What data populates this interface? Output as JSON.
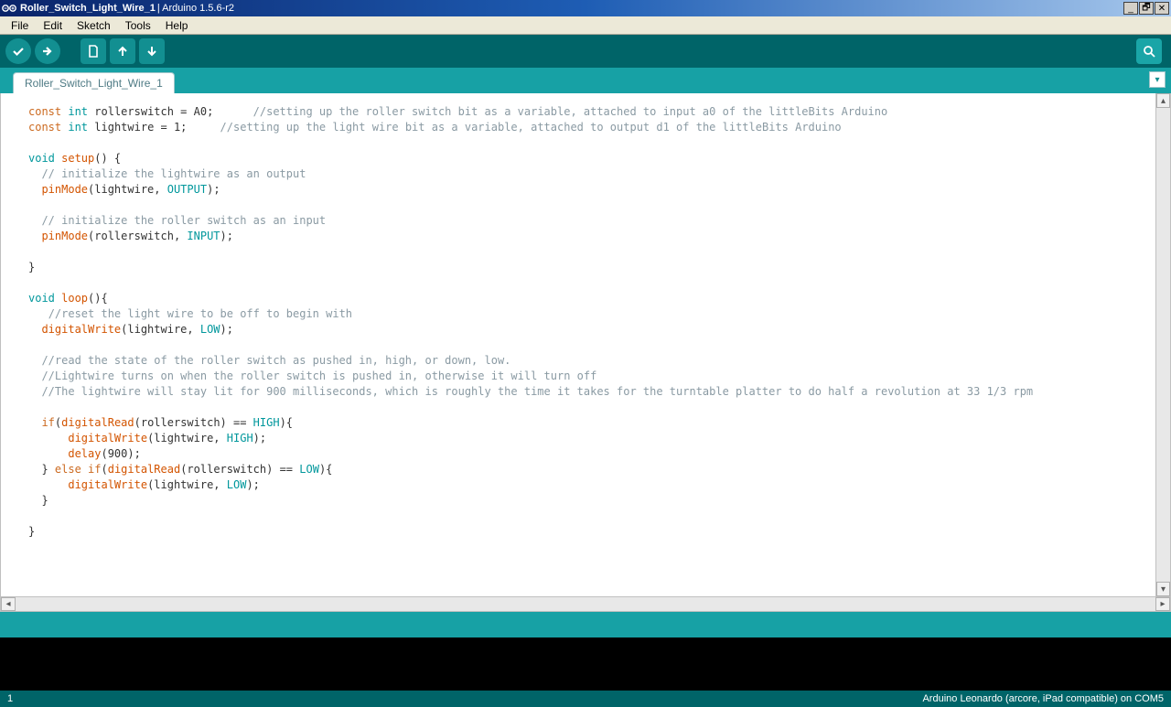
{
  "window": {
    "title_prefix": "Roller_Switch_Light_Wire_1",
    "title_suffix": " | Arduino 1.5.6-r2"
  },
  "menus": {
    "file": "File",
    "edit": "Edit",
    "sketch": "Sketch",
    "tools": "Tools",
    "help": "Help"
  },
  "tab": {
    "name": "Roller_Switch_Light_Wire_1"
  },
  "code": {
    "lines": [
      [
        [
          "kw",
          "const "
        ],
        [
          "type",
          "int "
        ],
        [
          "",
          "rollerswitch = A0;      "
        ],
        [
          "cmt",
          "//setting up the roller switch bit as a variable, attached to input a0 of the littleBits Arduino"
        ]
      ],
      [
        [
          "kw",
          "const "
        ],
        [
          "type",
          "int "
        ],
        [
          "",
          "lightwire = 1;     "
        ],
        [
          "cmt",
          "//setting up the light wire bit as a variable, attached to output d1 of the littleBits Arduino"
        ]
      ],
      [
        [
          "",
          ""
        ]
      ],
      [
        [
          "type",
          "void "
        ],
        [
          "func",
          "setup"
        ],
        [
          "",
          "() {"
        ]
      ],
      [
        [
          "",
          "  "
        ],
        [
          "cmt",
          "// initialize the lightwire as an output"
        ]
      ],
      [
        [
          "",
          "  "
        ],
        [
          "func",
          "pinMode"
        ],
        [
          "",
          "(lightwire, "
        ],
        [
          "lit",
          "OUTPUT"
        ],
        [
          "",
          ");"
        ]
      ],
      [
        [
          "",
          ""
        ]
      ],
      [
        [
          "",
          "  "
        ],
        [
          "cmt",
          "// initialize the roller switch as an input"
        ]
      ],
      [
        [
          "",
          "  "
        ],
        [
          "func",
          "pinMode"
        ],
        [
          "",
          "(rollerswitch, "
        ],
        [
          "lit",
          "INPUT"
        ],
        [
          "",
          ");"
        ]
      ],
      [
        [
          "",
          ""
        ]
      ],
      [
        [
          "",
          "}"
        ]
      ],
      [
        [
          "",
          ""
        ]
      ],
      [
        [
          "type",
          "void "
        ],
        [
          "func",
          "loop"
        ],
        [
          "",
          "(){"
        ]
      ],
      [
        [
          "",
          "   "
        ],
        [
          "cmt",
          "//reset the light wire to be off to begin with"
        ]
      ],
      [
        [
          "",
          "  "
        ],
        [
          "func",
          "digitalWrite"
        ],
        [
          "",
          "(lightwire, "
        ],
        [
          "lit",
          "LOW"
        ],
        [
          "",
          ");"
        ]
      ],
      [
        [
          "",
          ""
        ]
      ],
      [
        [
          "",
          "  "
        ],
        [
          "cmt",
          "//read the state of the roller switch as pushed in, high, or down, low."
        ]
      ],
      [
        [
          "",
          "  "
        ],
        [
          "cmt",
          "//Lightwire turns on when the roller switch is pushed in, otherwise it will turn off"
        ]
      ],
      [
        [
          "",
          "  "
        ],
        [
          "cmt",
          "//The lightwire will stay lit for 900 milliseconds, which is roughly the time it takes for the turntable platter to do half a revolution at 33 1/3 rpm"
        ]
      ],
      [
        [
          "",
          ""
        ]
      ],
      [
        [
          "",
          "  "
        ],
        [
          "kw",
          "if"
        ],
        [
          "",
          "("
        ],
        [
          "func",
          "digitalRead"
        ],
        [
          "",
          "(rollerswitch) == "
        ],
        [
          "lit",
          "HIGH"
        ],
        [
          "",
          "){"
        ]
      ],
      [
        [
          "",
          "      "
        ],
        [
          "func",
          "digitalWrite"
        ],
        [
          "",
          "(lightwire, "
        ],
        [
          "lit",
          "HIGH"
        ],
        [
          "",
          ");"
        ]
      ],
      [
        [
          "",
          "      "
        ],
        [
          "func",
          "delay"
        ],
        [
          "",
          "(900);"
        ]
      ],
      [
        [
          "",
          "  } "
        ],
        [
          "kw",
          "else if"
        ],
        [
          "",
          "("
        ],
        [
          "func",
          "digitalRead"
        ],
        [
          "",
          "(rollerswitch) == "
        ],
        [
          "lit",
          "LOW"
        ],
        [
          "",
          "){"
        ]
      ],
      [
        [
          "",
          "      "
        ],
        [
          "func",
          "digitalWrite"
        ],
        [
          "",
          "(lightwire, "
        ],
        [
          "lit",
          "LOW"
        ],
        [
          "",
          ");"
        ]
      ],
      [
        [
          "",
          "  }"
        ]
      ],
      [
        [
          "",
          ""
        ]
      ],
      [
        [
          "",
          "}"
        ]
      ]
    ]
  },
  "status": {
    "left": "1",
    "right": "Arduino Leonardo (arcore, iPad compatible) on COM5"
  }
}
